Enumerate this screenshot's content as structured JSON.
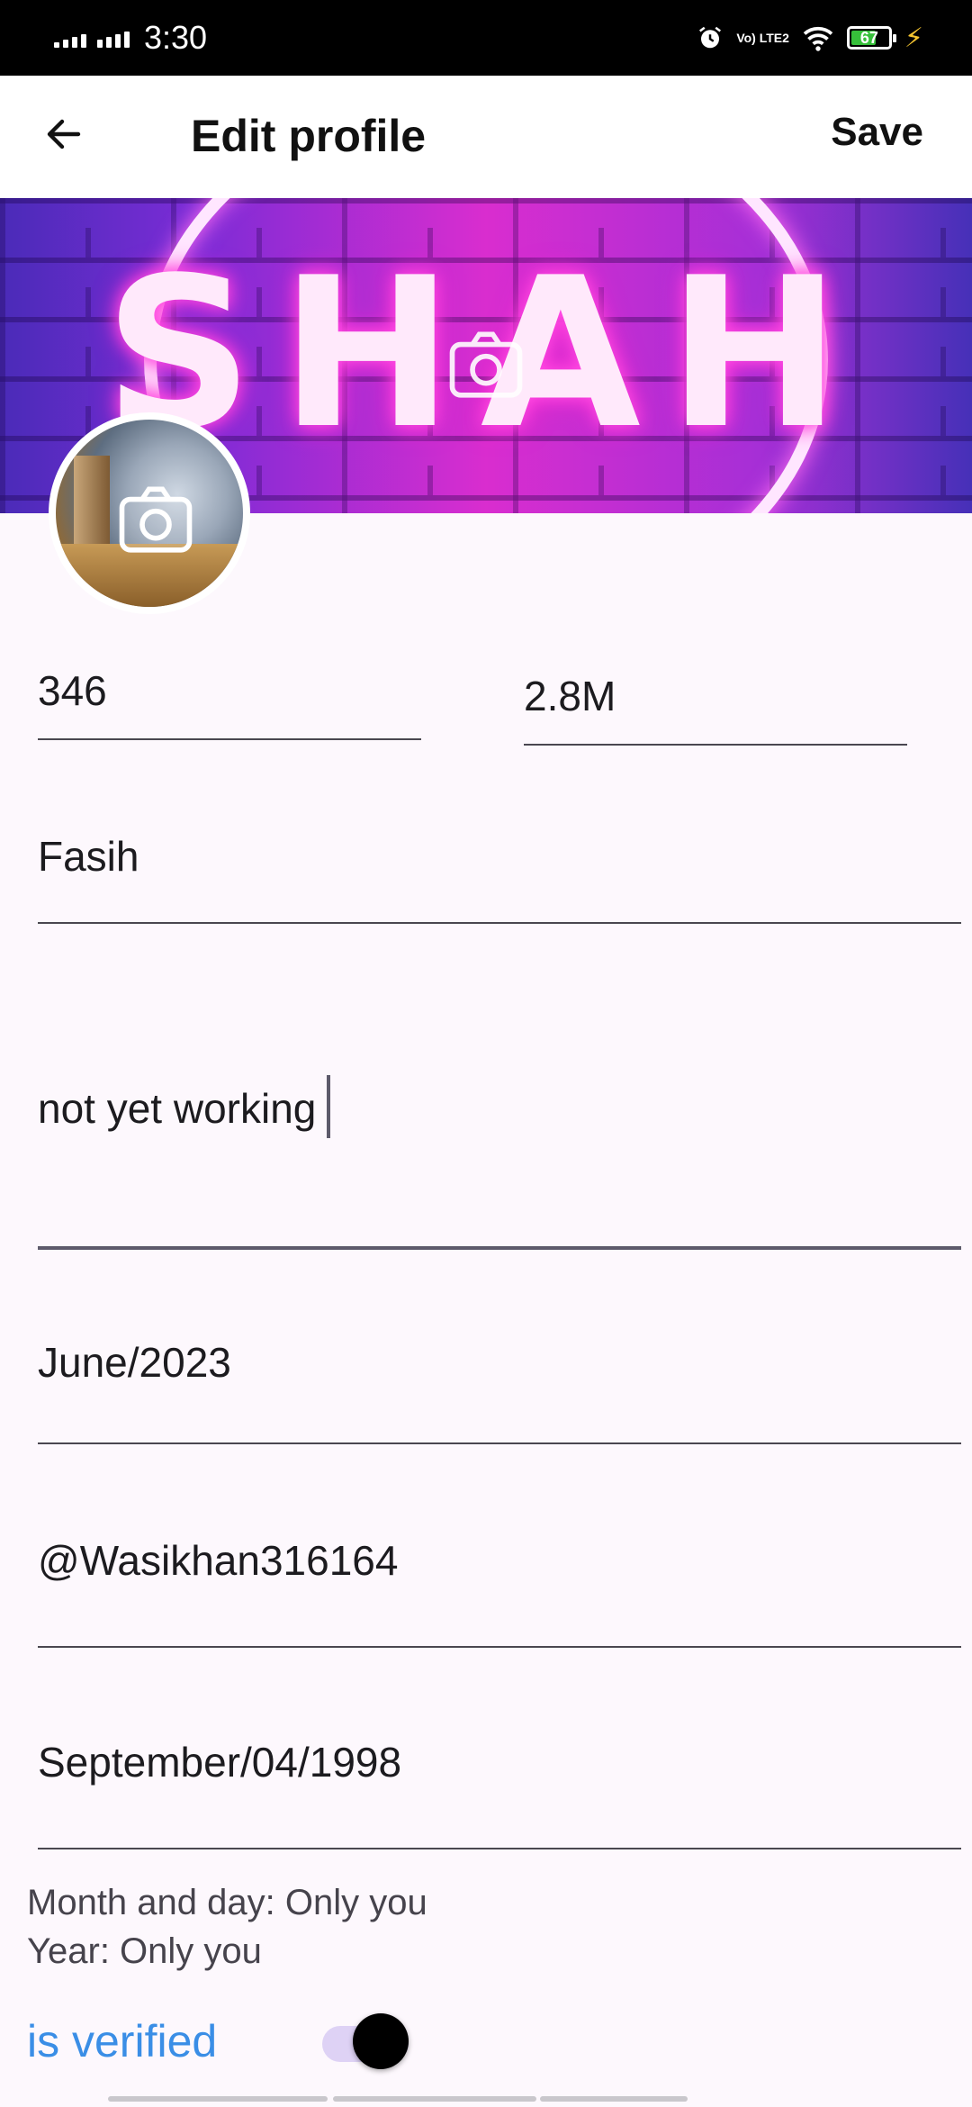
{
  "status_bar": {
    "time": "3:30",
    "network_label": "Vo) LTE2",
    "battery_level": "67",
    "battery_fraction": 0.67,
    "icons": [
      "signal-icon",
      "signal-icon",
      "alarm-icon",
      "lte-icon",
      "wifi-icon",
      "battery-icon",
      "charging-icon"
    ]
  },
  "app_bar": {
    "title": "Edit profile",
    "save_label": "Save",
    "back_icon": "arrow-left-icon"
  },
  "banner": {
    "text": "SHAH",
    "camera_icon": "camera-icon"
  },
  "avatar": {
    "camera_icon": "camera-icon"
  },
  "fields": {
    "followers": "346",
    "following": "2.8M",
    "name": "Fasih",
    "bio": "not yet working",
    "joined": "June/2023",
    "handle": "@Wasikhan316164",
    "birth_date": "September/04/1998"
  },
  "privacy": {
    "month_day": "Month and day: Only you",
    "year": "Year: Only you"
  },
  "verified": {
    "label": "is verified",
    "on": true,
    "accent": "#3a8ee6"
  }
}
